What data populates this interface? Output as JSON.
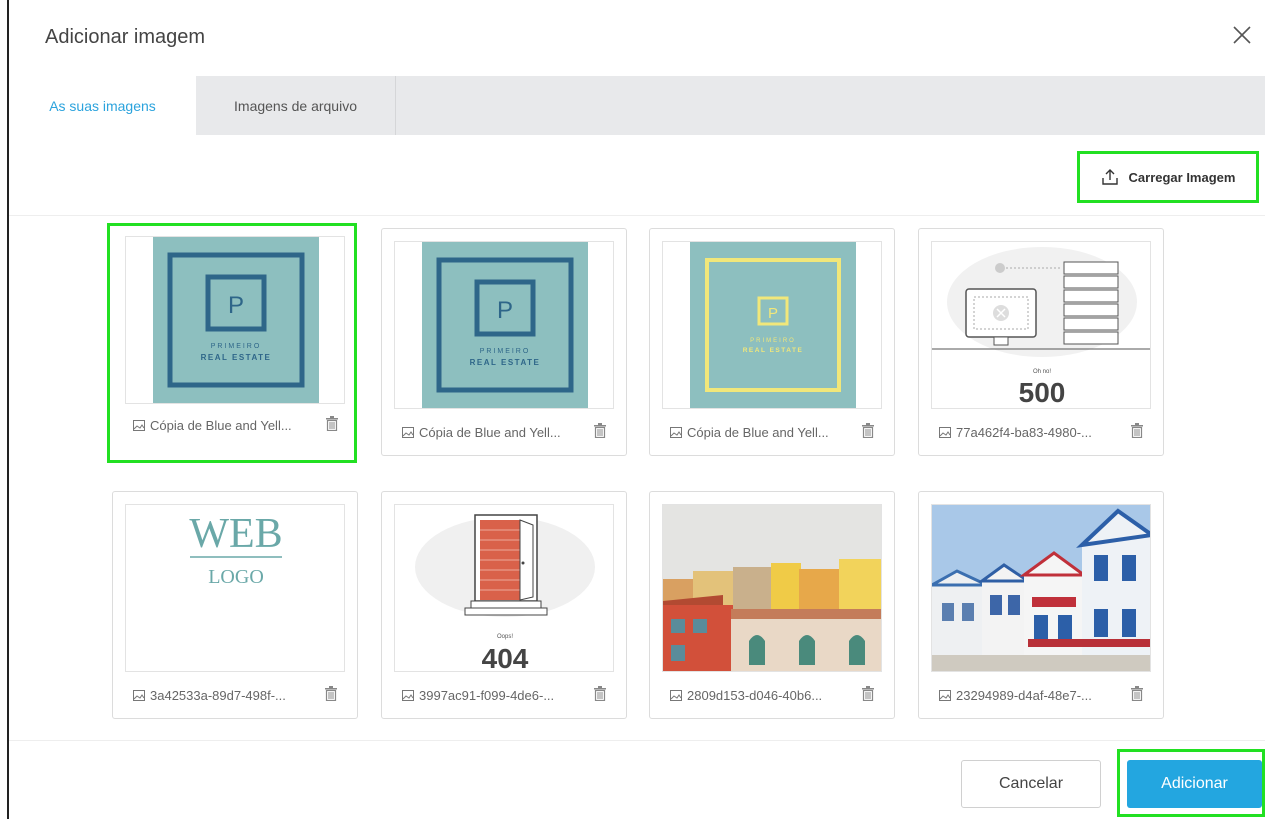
{
  "dialog": {
    "title": "Adicionar imagem"
  },
  "tabs": [
    {
      "label": "As suas imagens",
      "active": true
    },
    {
      "label": "Imagens de arquivo",
      "active": false
    }
  ],
  "toolbar": {
    "upload_label": "Carregar Imagem",
    "upload_icon": "upload-icon"
  },
  "images": [
    {
      "filename": "Cópia de Blue and Yell...",
      "selected": true,
      "thumb_brand_letter": "P",
      "thumb_line1": "PRIMEIRO",
      "thumb_line2": "REAL ESTATE"
    },
    {
      "filename": "Cópia de Blue and Yell...",
      "selected": false,
      "thumb_brand_letter": "P",
      "thumb_line1": "PRIMEIRO",
      "thumb_line2": "REAL ESTATE"
    },
    {
      "filename": "Cópia de Blue and Yell...",
      "selected": false,
      "thumb_brand_letter": "P",
      "thumb_line1": "PRIMEIRO",
      "thumb_line2": "REAL ESTATE"
    },
    {
      "filename": "77a462f4-ba83-4980-...",
      "selected": false,
      "thumb_small": "Oh no!",
      "thumb_code": "500"
    },
    {
      "filename": "3a42533a-89d7-498f-...",
      "selected": false,
      "thumb_line1": "WEB",
      "thumb_line2": "LOGO"
    },
    {
      "filename": "3997ac91-f099-4de6-...",
      "selected": false,
      "thumb_small": "Oops!",
      "thumb_code": "404"
    },
    {
      "filename": "2809d153-d046-40b6...",
      "selected": false
    },
    {
      "filename": "23294989-d4af-48e7-...",
      "selected": false
    }
  ],
  "footer": {
    "cancel_label": "Cancelar",
    "add_label": "Adicionar"
  },
  "colors": {
    "accent": "#23a6e0",
    "highlight": "#22e022",
    "tab_active_text": "#2ba3dd",
    "teal_thumb": "#8dbfbf"
  }
}
